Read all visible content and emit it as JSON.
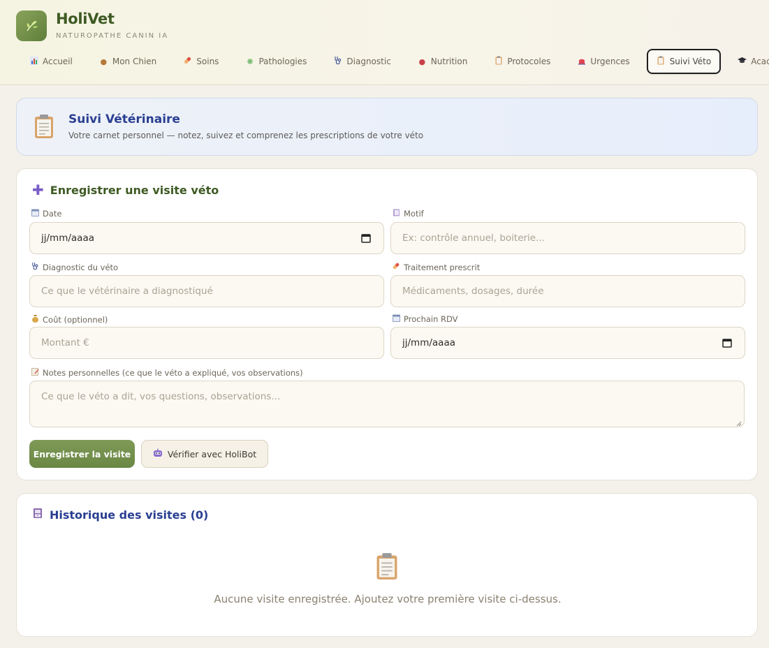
{
  "app": {
    "name": "HoliVet",
    "subtitle": "NATUROPATHE CANIN IA",
    "logo_icon": "leaf-icon"
  },
  "nav": [
    {
      "label": "Accueil",
      "icon": "bar-chart-icon",
      "active": false
    },
    {
      "label": "Mon Chien",
      "icon": "dog-icon",
      "active": false
    },
    {
      "label": "Soins",
      "icon": "pill-icon",
      "active": false
    },
    {
      "label": "Pathologies",
      "icon": "microbe-icon",
      "active": false
    },
    {
      "label": "Diagnostic",
      "icon": "stethoscope-icon",
      "active": false
    },
    {
      "label": "Nutrition",
      "icon": "meat-icon",
      "active": false
    },
    {
      "label": "Protocoles",
      "icon": "clipboard-icon",
      "active": false
    },
    {
      "label": "Urgences",
      "icon": "siren-icon",
      "active": false
    },
    {
      "label": "Suivi Véto",
      "icon": "clipboard-icon",
      "active": true
    },
    {
      "label": "Académie",
      "icon": "graduation-cap-icon",
      "active": false
    }
  ],
  "banner": {
    "title": "Suivi Vétérinaire",
    "subtitle": "Votre carnet personnel — notez, suivez et comprenez les prescriptions de votre véto"
  },
  "form": {
    "title": "Enregistrer une visite véto",
    "date": {
      "label": "Date",
      "value": "jj/mm/aaaa"
    },
    "motif": {
      "label": "Motif",
      "placeholder": "Ex: contrôle annuel, boiterie..."
    },
    "diagnostic": {
      "label": "Diagnostic du véto",
      "placeholder": "Ce que le vétérinaire a diagnostiqué"
    },
    "traitement": {
      "label": "Traitement prescrit",
      "placeholder": "Médicaments, dosages, durée"
    },
    "cout": {
      "label": "Coût (optionnel)",
      "placeholder": "Montant €"
    },
    "rdv": {
      "label": "Prochain RDV",
      "value": "jj/mm/aaaa"
    },
    "notes": {
      "label": "Notes personnelles (ce que le véto a expliqué, vos observations)",
      "placeholder": "Ce que le véto a dit, vos questions, observations..."
    },
    "save_label": "Enregistrer la visite",
    "check_label": "Vérifier avec HoliBot"
  },
  "history": {
    "title": "Historique des visites (0)",
    "empty_text": "Aucune visite enregistrée. Ajoutez votre première visite ci-dessus."
  },
  "colors": {
    "accent_green": "#6a8744",
    "title_blue": "#2a3f92",
    "page_bg": "#f4f1ea"
  }
}
